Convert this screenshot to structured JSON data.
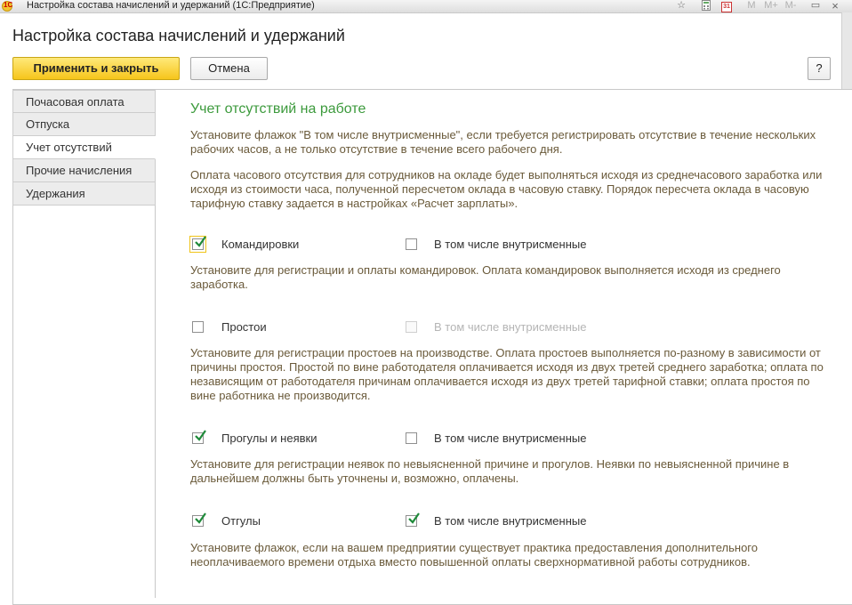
{
  "window": {
    "title": "Настройка состава начислений и удержаний  (1С:Предприятие)",
    "app_logo": "1С",
    "toolbar_glyphs": [
      "M",
      "M+",
      "M-"
    ],
    "calendar_day": "31",
    "minimize": "▭",
    "close": "×"
  },
  "form": {
    "title": "Настройка состава начислений и удержаний",
    "apply_label": "Применить и закрыть",
    "cancel_label": "Отмена",
    "help_label": "?"
  },
  "nav": {
    "items": [
      {
        "label": "Почасовая оплата",
        "active": false
      },
      {
        "label": "Отпуска",
        "active": false
      },
      {
        "label": "Учет отсутствий",
        "active": true
      },
      {
        "label": "Прочие начисления",
        "active": false
      },
      {
        "label": "Удержания",
        "active": false
      }
    ]
  },
  "content": {
    "title": "Учет отсутствий на работе",
    "intro_lines": [
      "Установите флажок \"В том числе внутрисменные\", если требуется регистрировать отсутствие в течение нескольких",
      "рабочих часов, а не только отсутствие в течение всего рабочего дня."
    ],
    "note_lines": [
      "Оплата часового отсутствия для сотрудников на окладе будет выполняться исходя из среднечасового заработка или",
      "исходя из стоимости часа, полученной пересчетом оклада в часовую ставку. Порядок пересчета оклада в часовую",
      "тарифную ставку задается в настройках «Расчет зарплаты»."
    ],
    "options": [
      {
        "label": "Командировки",
        "checked": true,
        "focused": true,
        "intra_label": "В том числе внутрисменные",
        "intra_checked": false,
        "intra_disabled": false,
        "desc_lines": [
          "Установите для регистрации и оплаты командировок. Оплата командировок выполняется исходя из среднего",
          "заработка."
        ]
      },
      {
        "label": "Простои",
        "checked": false,
        "focused": false,
        "intra_label": "В том числе внутрисменные",
        "intra_checked": false,
        "intra_disabled": true,
        "desc_lines": [
          "Установите для регистрации простоев на производстве. Оплата простоев выполняется по-разному в зависимости от",
          "причины простоя. Простой по вине работодателя оплачивается исходя из двух третей среднего заработка; оплата по",
          "независящим от работодателя причинам оплачивается исходя из двух третей тарифной ставки; оплата простоя по",
          "вине работника не производится."
        ]
      },
      {
        "label": "Прогулы и неявки",
        "checked": true,
        "focused": false,
        "intra_label": "В том числе внутрисменные",
        "intra_checked": false,
        "intra_disabled": false,
        "desc_lines": [
          "Установите для регистрации неявок по невыясненной причине и прогулов. Неявки по невыясненной причине в",
          "дальнейшем должны быть уточнены и, возможно, оплачены."
        ]
      },
      {
        "label": "Отгулы",
        "checked": true,
        "focused": false,
        "intra_label": "В том числе внутрисменные",
        "intra_checked": true,
        "intra_disabled": false,
        "desc_lines": [
          "Установите флажок, если на вашем предприятии существует практика предоставления дополнительного",
          "неоплачиваемого времени отдыха вместо повышенной оплаты сверхнормативной работы сотрудников."
        ]
      }
    ]
  }
}
